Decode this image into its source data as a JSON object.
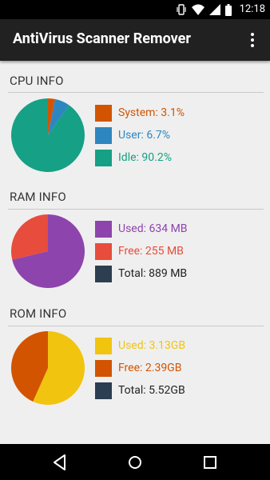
{
  "status": {
    "time": "12:18"
  },
  "app_bar": {
    "title": "AntiVirus Scanner Remover"
  },
  "cpu": {
    "title": "CPU INFO",
    "items": [
      {
        "label": "System: 3.1%",
        "color": "#d35400",
        "fraction": 0.031
      },
      {
        "label": "User: 6.7%",
        "color": "#2e86c1",
        "fraction": 0.067
      },
      {
        "label": "Idle: 90.2%",
        "color": "#16a085",
        "fraction": 0.902
      }
    ]
  },
  "ram": {
    "title": "RAM INFO",
    "items": [
      {
        "label": "Used: 634 MB",
        "color": "#8e44ad",
        "fraction": 0.713
      },
      {
        "label": "Free: 255 MB",
        "color": "#e74c3c",
        "fraction": 0.287
      },
      {
        "label": "Total: 889 MB",
        "color": "#2c3e50"
      }
    ]
  },
  "rom": {
    "title": "ROM INFO",
    "items": [
      {
        "label": "Used: 3.13GB",
        "color": "#f1c40f",
        "fraction": 0.567
      },
      {
        "label": "Free: 2.39GB",
        "color": "#d35400",
        "fraction": 0.433
      },
      {
        "label": "Total: 5.52GB",
        "color": "#2c3e50"
      }
    ]
  },
  "icons": [
    "vibrate-icon",
    "wifi-icon",
    "signal-icon",
    "battery-icon",
    "overflow-menu-icon",
    "back-icon",
    "home-icon",
    "recents-icon"
  ]
}
